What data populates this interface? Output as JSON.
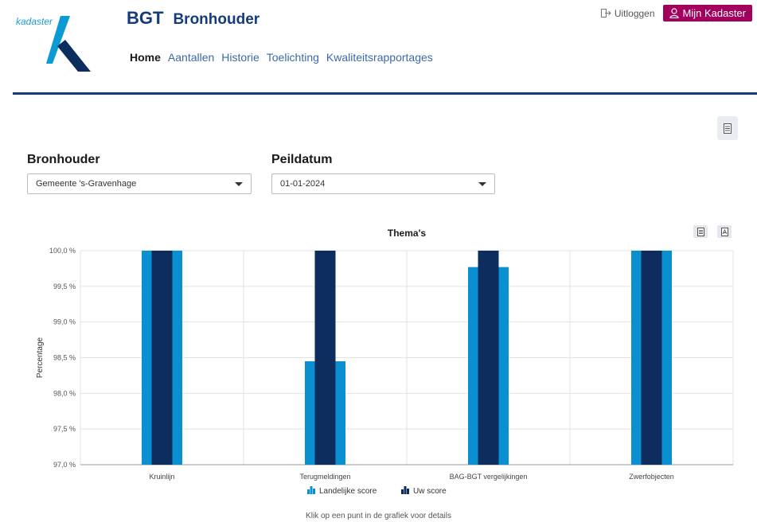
{
  "logo": {
    "text": "kadaster"
  },
  "header": {
    "app_name": "BGT",
    "app_sub": "Bronhouder"
  },
  "nav": {
    "items": [
      "Home",
      "Aantallen",
      "Historie",
      "Toelichting",
      "Kwaliteitsrapportages"
    ],
    "active": 0
  },
  "actions": {
    "logout": "Uitloggen",
    "mijn": "Mijn Kadaster"
  },
  "filters": {
    "bronhouder_label": "Bronhouder",
    "bronhouder_value": "Gemeente 's-Gravenhage",
    "peildatum_label": "Peildatum",
    "peildatum_value": "01-01-2024"
  },
  "colors": {
    "landelijk": "#0a8fd0",
    "uw": "#0d2d5e",
    "brand": "#143c7a",
    "accent": "#a3005e"
  },
  "chart_data": {
    "type": "bar",
    "title": "Thema's",
    "ylabel": "Percentage",
    "xlabel": "",
    "categories": [
      "Kruinlijn",
      "Terugmeldingen",
      "BAG-BGT vergelijkingen",
      "Zwerfobjecten"
    ],
    "series": [
      {
        "name": "Landelijke score",
        "values": [
          100.0,
          98.45,
          99.77,
          100.0
        ]
      },
      {
        "name": "Uw score",
        "values": [
          100.0,
          100.0,
          100.0,
          100.0
        ]
      }
    ],
    "ylim": [
      97.0,
      100.0
    ],
    "yticks": [
      "97,0 %",
      "97,5 %",
      "98,0 %",
      "98,5 %",
      "99,0 %",
      "99,5 %",
      "100,0 %"
    ],
    "ytick_values": [
      97.0,
      97.5,
      98.0,
      98.5,
      99.0,
      99.5,
      100.0
    ],
    "grid": true,
    "legend": "bottom"
  },
  "footnote": "Klik op een punt in de grafiek voor details"
}
